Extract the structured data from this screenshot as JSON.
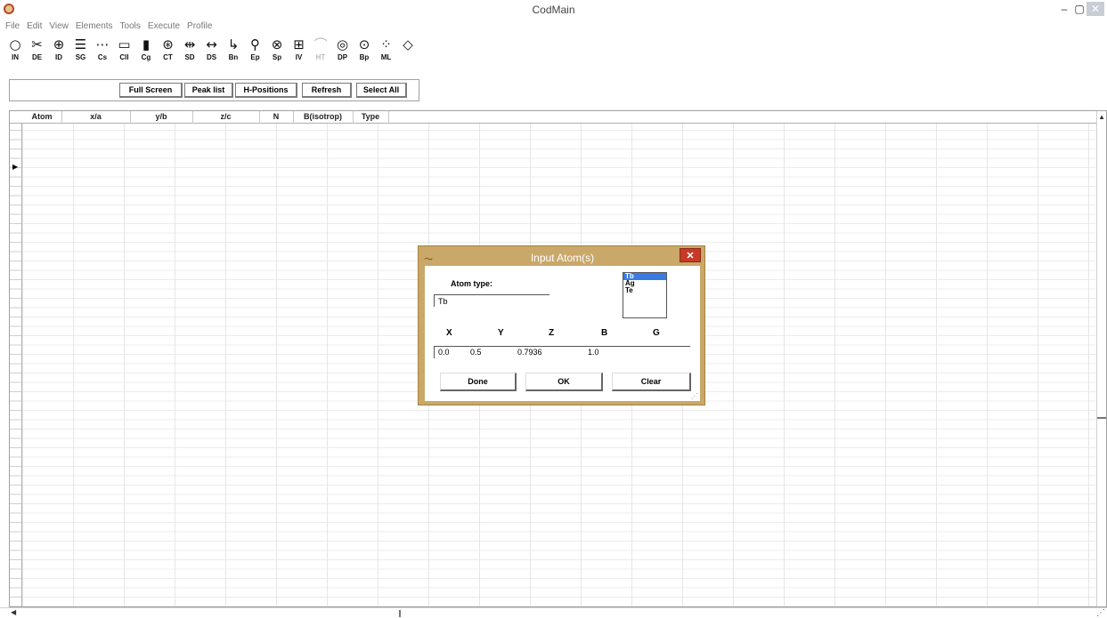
{
  "window": {
    "title": "CodMain",
    "minimize": "–",
    "maximize": "▢",
    "close": "✕"
  },
  "menu": [
    "File",
    "Edit",
    "View",
    "Elements",
    "Tools",
    "Execute",
    "Profile"
  ],
  "toolbar": [
    {
      "icon": "○",
      "label": "IN",
      "name": "in-tool-icon"
    },
    {
      "icon": "✂",
      "label": "DE",
      "name": "scissors-icon"
    },
    {
      "icon": "⊕",
      "label": "ID",
      "name": "id-tool-icon"
    },
    {
      "icon": "☰",
      "label": "SG",
      "name": "sg-tool-icon"
    },
    {
      "icon": "⋯",
      "label": "Cs",
      "name": "cs-tool-icon"
    },
    {
      "icon": "▭",
      "label": "Cll",
      "name": "cell-tool-icon"
    },
    {
      "icon": "▮",
      "label": "Cg",
      "name": "cg-tool-icon"
    },
    {
      "icon": "⊛",
      "label": "CT",
      "name": "ct-tool-icon"
    },
    {
      "icon": "⇹",
      "label": "SD",
      "name": "sd-tool-icon"
    },
    {
      "icon": "↔",
      "label": "DS",
      "name": "ds-tool-icon"
    },
    {
      "icon": "↳",
      "label": "Bn",
      "name": "bn-tool-icon"
    },
    {
      "icon": "⚲",
      "label": "Ep",
      "name": "ep-tool-icon"
    },
    {
      "icon": "⊗",
      "label": "Sp",
      "name": "sp-tool-icon"
    },
    {
      "icon": "⊞",
      "label": "IV",
      "name": "iv-tool-icon"
    },
    {
      "icon": "⌒",
      "label": "HT",
      "name": "ht-tool-icon"
    },
    {
      "icon": "◎",
      "label": "DP",
      "name": "dp-tool-icon"
    },
    {
      "icon": "⊙",
      "label": "Bp",
      "name": "bp-tool-icon"
    },
    {
      "icon": "⁘",
      "label": "ML",
      "name": "ml-tool-icon"
    },
    {
      "icon": "◇",
      "label": "",
      "name": "diamond-icon"
    }
  ],
  "buttons": {
    "full_screen": "Full Screen",
    "peak_list": "Peak list",
    "h_positions": "H-Positions",
    "refresh": "Refresh",
    "select_all": "Select All"
  },
  "grid": {
    "columns": [
      "Atom",
      "x/a",
      "y/b",
      "z/c",
      "N",
      "B(isotrop)",
      "Type"
    ]
  },
  "dialog": {
    "title": "Input Atom(s)",
    "close": "✕",
    "atom_type_label": "Atom type:",
    "atom_type_value": "Tb",
    "element_options": [
      "Tb",
      "Ag",
      "Te"
    ],
    "selected_element": "Tb",
    "coord_labels": [
      "X",
      "Y",
      "Z",
      "B",
      "G"
    ],
    "coord_values": [
      "0.0",
      "0.5",
      "0.7936",
      "1.0"
    ],
    "done": "Done",
    "ok": "OK",
    "clear": "Clear"
  }
}
